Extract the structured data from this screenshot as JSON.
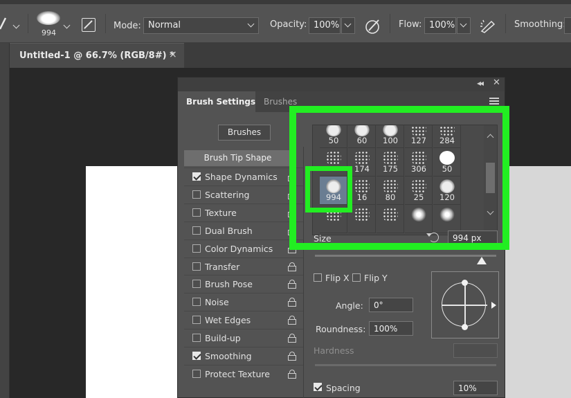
{
  "options_bar": {
    "brush_size": "994",
    "mode_label": "Mode:",
    "mode_value": "Normal",
    "opacity_label": "Opacity:",
    "opacity_value": "100%",
    "flow_label": "Flow:",
    "flow_value": "100%",
    "smoothing_label": "Smoothing:"
  },
  "document_tab": {
    "title": "Untitled-1 @ 66.7% (RGB/8#) *",
    "close": "×"
  },
  "panel": {
    "tabs": [
      {
        "label": "Brush Settings",
        "active": true
      },
      {
        "label": "Brushes",
        "active": false
      }
    ],
    "brushes_button": "Brushes",
    "tip_shape": "Brush Tip Shape",
    "options": [
      {
        "label": "Shape Dynamics",
        "checked": true
      },
      {
        "label": "Scattering",
        "checked": false
      },
      {
        "label": "Texture",
        "checked": false
      },
      {
        "label": "Dual Brush",
        "checked": false
      },
      {
        "label": "Color Dynamics",
        "checked": false
      },
      {
        "label": "Transfer",
        "checked": false
      },
      {
        "label": "Brush Pose",
        "checked": false
      },
      {
        "label": "Noise",
        "checked": false
      },
      {
        "label": "Wet Edges",
        "checked": false
      },
      {
        "label": "Build-up",
        "checked": false
      },
      {
        "label": "Smoothing",
        "checked": true
      },
      {
        "label": "Protect Texture",
        "checked": false
      }
    ],
    "presets": [
      {
        "size": "50",
        "kind": "cloud"
      },
      {
        "size": "60",
        "kind": "cloud"
      },
      {
        "size": "100",
        "kind": "cloud"
      },
      {
        "size": "127",
        "kind": "scatter"
      },
      {
        "size": "284",
        "kind": "scatter"
      },
      {
        "size": "",
        "kind": "scatter"
      },
      {
        "size": "174",
        "kind": "scatter"
      },
      {
        "size": "175",
        "kind": "scatter"
      },
      {
        "size": "306",
        "kind": "scatter"
      },
      {
        "size": "50",
        "kind": "solid"
      },
      {
        "size": "994",
        "kind": "cloud",
        "selected": true
      },
      {
        "size": "16",
        "kind": "scatter"
      },
      {
        "size": "80",
        "kind": "scatter"
      },
      {
        "size": "25",
        "kind": "scatter"
      },
      {
        "size": "120",
        "kind": "cloud"
      },
      {
        "size": "",
        "kind": "scatter"
      },
      {
        "size": "",
        "kind": "scatter"
      },
      {
        "size": "",
        "kind": "scatter"
      },
      {
        "size": "",
        "kind": "soft"
      },
      {
        "size": "",
        "kind": "soft"
      }
    ],
    "size_label": "Size",
    "size_value": "994 px",
    "size_slider_fraction": 0.92,
    "flip_x": "Flip X",
    "flip_y": "Flip Y",
    "angle_label": "Angle:",
    "angle_value": "0°",
    "roundness_label": "Roundness:",
    "roundness_value": "100%",
    "hardness_label": "Hardness",
    "spacing_label": "Spacing",
    "spacing_value": "10%"
  },
  "colors": {
    "highlight": "#22ee22",
    "panel_bg": "#535353",
    "selection": "#6a7d92"
  }
}
